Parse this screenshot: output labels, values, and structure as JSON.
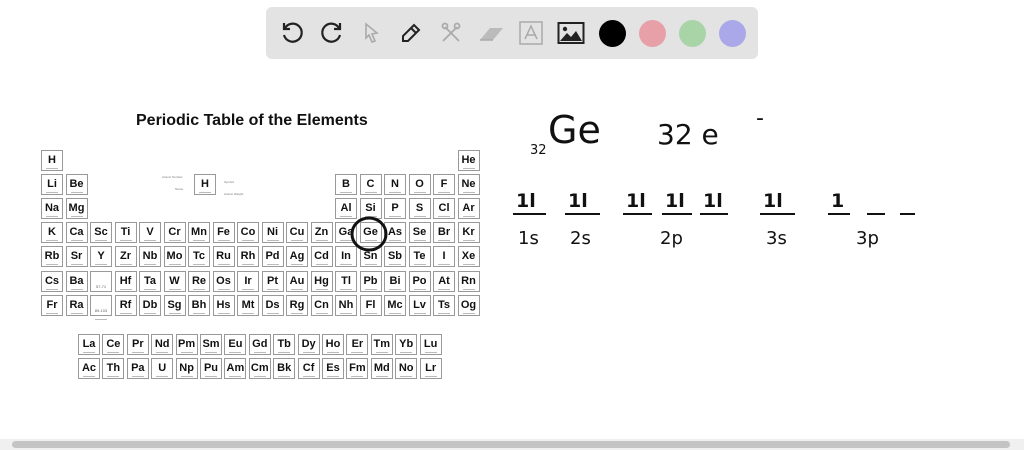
{
  "toolbar": {
    "tools": [
      "undo-icon",
      "redo-icon",
      "select-icon",
      "pen-icon",
      "tools-icon",
      "eraser-icon",
      "text-icon",
      "image-icon"
    ],
    "colors": [
      "#000000",
      "#e8a0a8",
      "#a8d4a8",
      "#aaa8e8"
    ]
  },
  "periodic_table": {
    "title": "Periodic Table of the Elements",
    "legend": {
      "symbol": "H",
      "labels": [
        "Atomic Number",
        "Name",
        "Symbol",
        "Atomic Weight"
      ]
    },
    "rows": [
      [
        "H",
        "",
        "",
        "",
        "",
        "",
        "",
        "",
        "",
        "",
        "",
        "",
        "",
        "",
        "",
        "",
        "",
        "He"
      ],
      [
        "Li",
        "Be",
        "",
        "",
        "",
        "",
        "",
        "",
        "",
        "",
        "",
        "",
        "B",
        "C",
        "N",
        "O",
        "F",
        "Ne"
      ],
      [
        "Na",
        "Mg",
        "",
        "",
        "",
        "",
        "",
        "",
        "",
        "",
        "",
        "",
        "Al",
        "Si",
        "P",
        "S",
        "Cl",
        "Ar"
      ],
      [
        "K",
        "Ca",
        "Sc",
        "Ti",
        "V",
        "Cr",
        "Mn",
        "Fe",
        "Co",
        "Ni",
        "Cu",
        "Zn",
        "Ga",
        "Ge",
        "As",
        "Se",
        "Br",
        "Kr"
      ],
      [
        "Rb",
        "Sr",
        "Y",
        "Zr",
        "Nb",
        "Mo",
        "Tc",
        "Ru",
        "Rh",
        "Pd",
        "Ag",
        "Cd",
        "In",
        "Sn",
        "Sb",
        "Te",
        "I",
        "Xe"
      ],
      [
        "Cs",
        "Ba",
        "57-71",
        "Hf",
        "Ta",
        "W",
        "Re",
        "Os",
        "Ir",
        "Pt",
        "Au",
        "Hg",
        "Tl",
        "Pb",
        "Bi",
        "Po",
        "At",
        "Rn"
      ],
      [
        "Fr",
        "Ra",
        "89-103",
        "Rf",
        "Db",
        "Sg",
        "Bh",
        "Hs",
        "Mt",
        "Ds",
        "Rg",
        "Cn",
        "Nh",
        "Fl",
        "Mc",
        "Lv",
        "Ts",
        "Og"
      ]
    ],
    "lanthanides": [
      "La",
      "Ce",
      "Pr",
      "Nd",
      "Pm",
      "Sm",
      "Eu",
      "Gd",
      "Tb",
      "Dy",
      "Ho",
      "Er",
      "Tm",
      "Yb",
      "Lu"
    ],
    "actinides": [
      "Ac",
      "Th",
      "Pa",
      "U",
      "Np",
      "Pu",
      "Am",
      "Cm",
      "Bk",
      "Cf",
      "Es",
      "Fm",
      "Md",
      "No",
      "Lr"
    ],
    "highlighted": "Ge"
  },
  "notes": {
    "element_symbol": "Ge",
    "atomic_number": "32",
    "electrons": "32 e",
    "electrons_sup": "-",
    "orbitals": [
      {
        "label": "1s",
        "boxes": [
          "1l"
        ]
      },
      {
        "label": "2s",
        "boxes": [
          "1l"
        ]
      },
      {
        "label": "2p",
        "boxes": [
          "1l",
          "1l",
          "1l"
        ]
      },
      {
        "label": "3s",
        "boxes": [
          "1l"
        ]
      },
      {
        "label": "3p",
        "boxes": [
          "1",
          "",
          ""
        ]
      }
    ]
  }
}
